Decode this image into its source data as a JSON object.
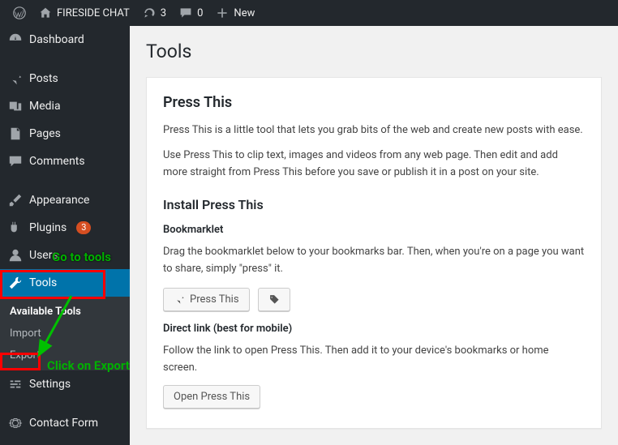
{
  "adminbar": {
    "site_title": "FIRESIDE CHAT",
    "updates_count": "3",
    "comments_count": "0",
    "new_label": "New"
  },
  "sidebar": {
    "dashboard": "Dashboard",
    "posts": "Posts",
    "media": "Media",
    "pages": "Pages",
    "comments": "Comments",
    "appearance": "Appearance",
    "plugins": "Plugins",
    "plugins_badge": "3",
    "users": "Users",
    "tools": "Tools",
    "tools_sub": {
      "available": "Available Tools",
      "import": "Import",
      "export": "Export"
    },
    "settings": "Settings",
    "contact_form": "Contact Form"
  },
  "page": {
    "title": "Tools",
    "h2_press_this": "Press This",
    "p1": "Press This is a little tool that lets you grab bits of the web and create new posts with ease.",
    "p2": "Use Press This to clip text, images and videos from any web page. Then edit and add more straight from Press This before you save or publish it in a post on your site.",
    "h3_install": "Install Press This",
    "bookmarklet_label": "Bookmarklet",
    "p3": "Drag the bookmarklet below to your bookmarks bar. Then, when you're on a page you want to share, simply \"press\" it.",
    "btn_press_this": "Press This",
    "direct_link_label": "Direct link (best for mobile)",
    "p4": "Follow the link to open Press This. Then add it to your device's bookmarks or home screen.",
    "btn_open_press_this": "Open Press This"
  },
  "annotations": {
    "goto_tools": "Go to tools",
    "click_export": "Click on Export"
  }
}
